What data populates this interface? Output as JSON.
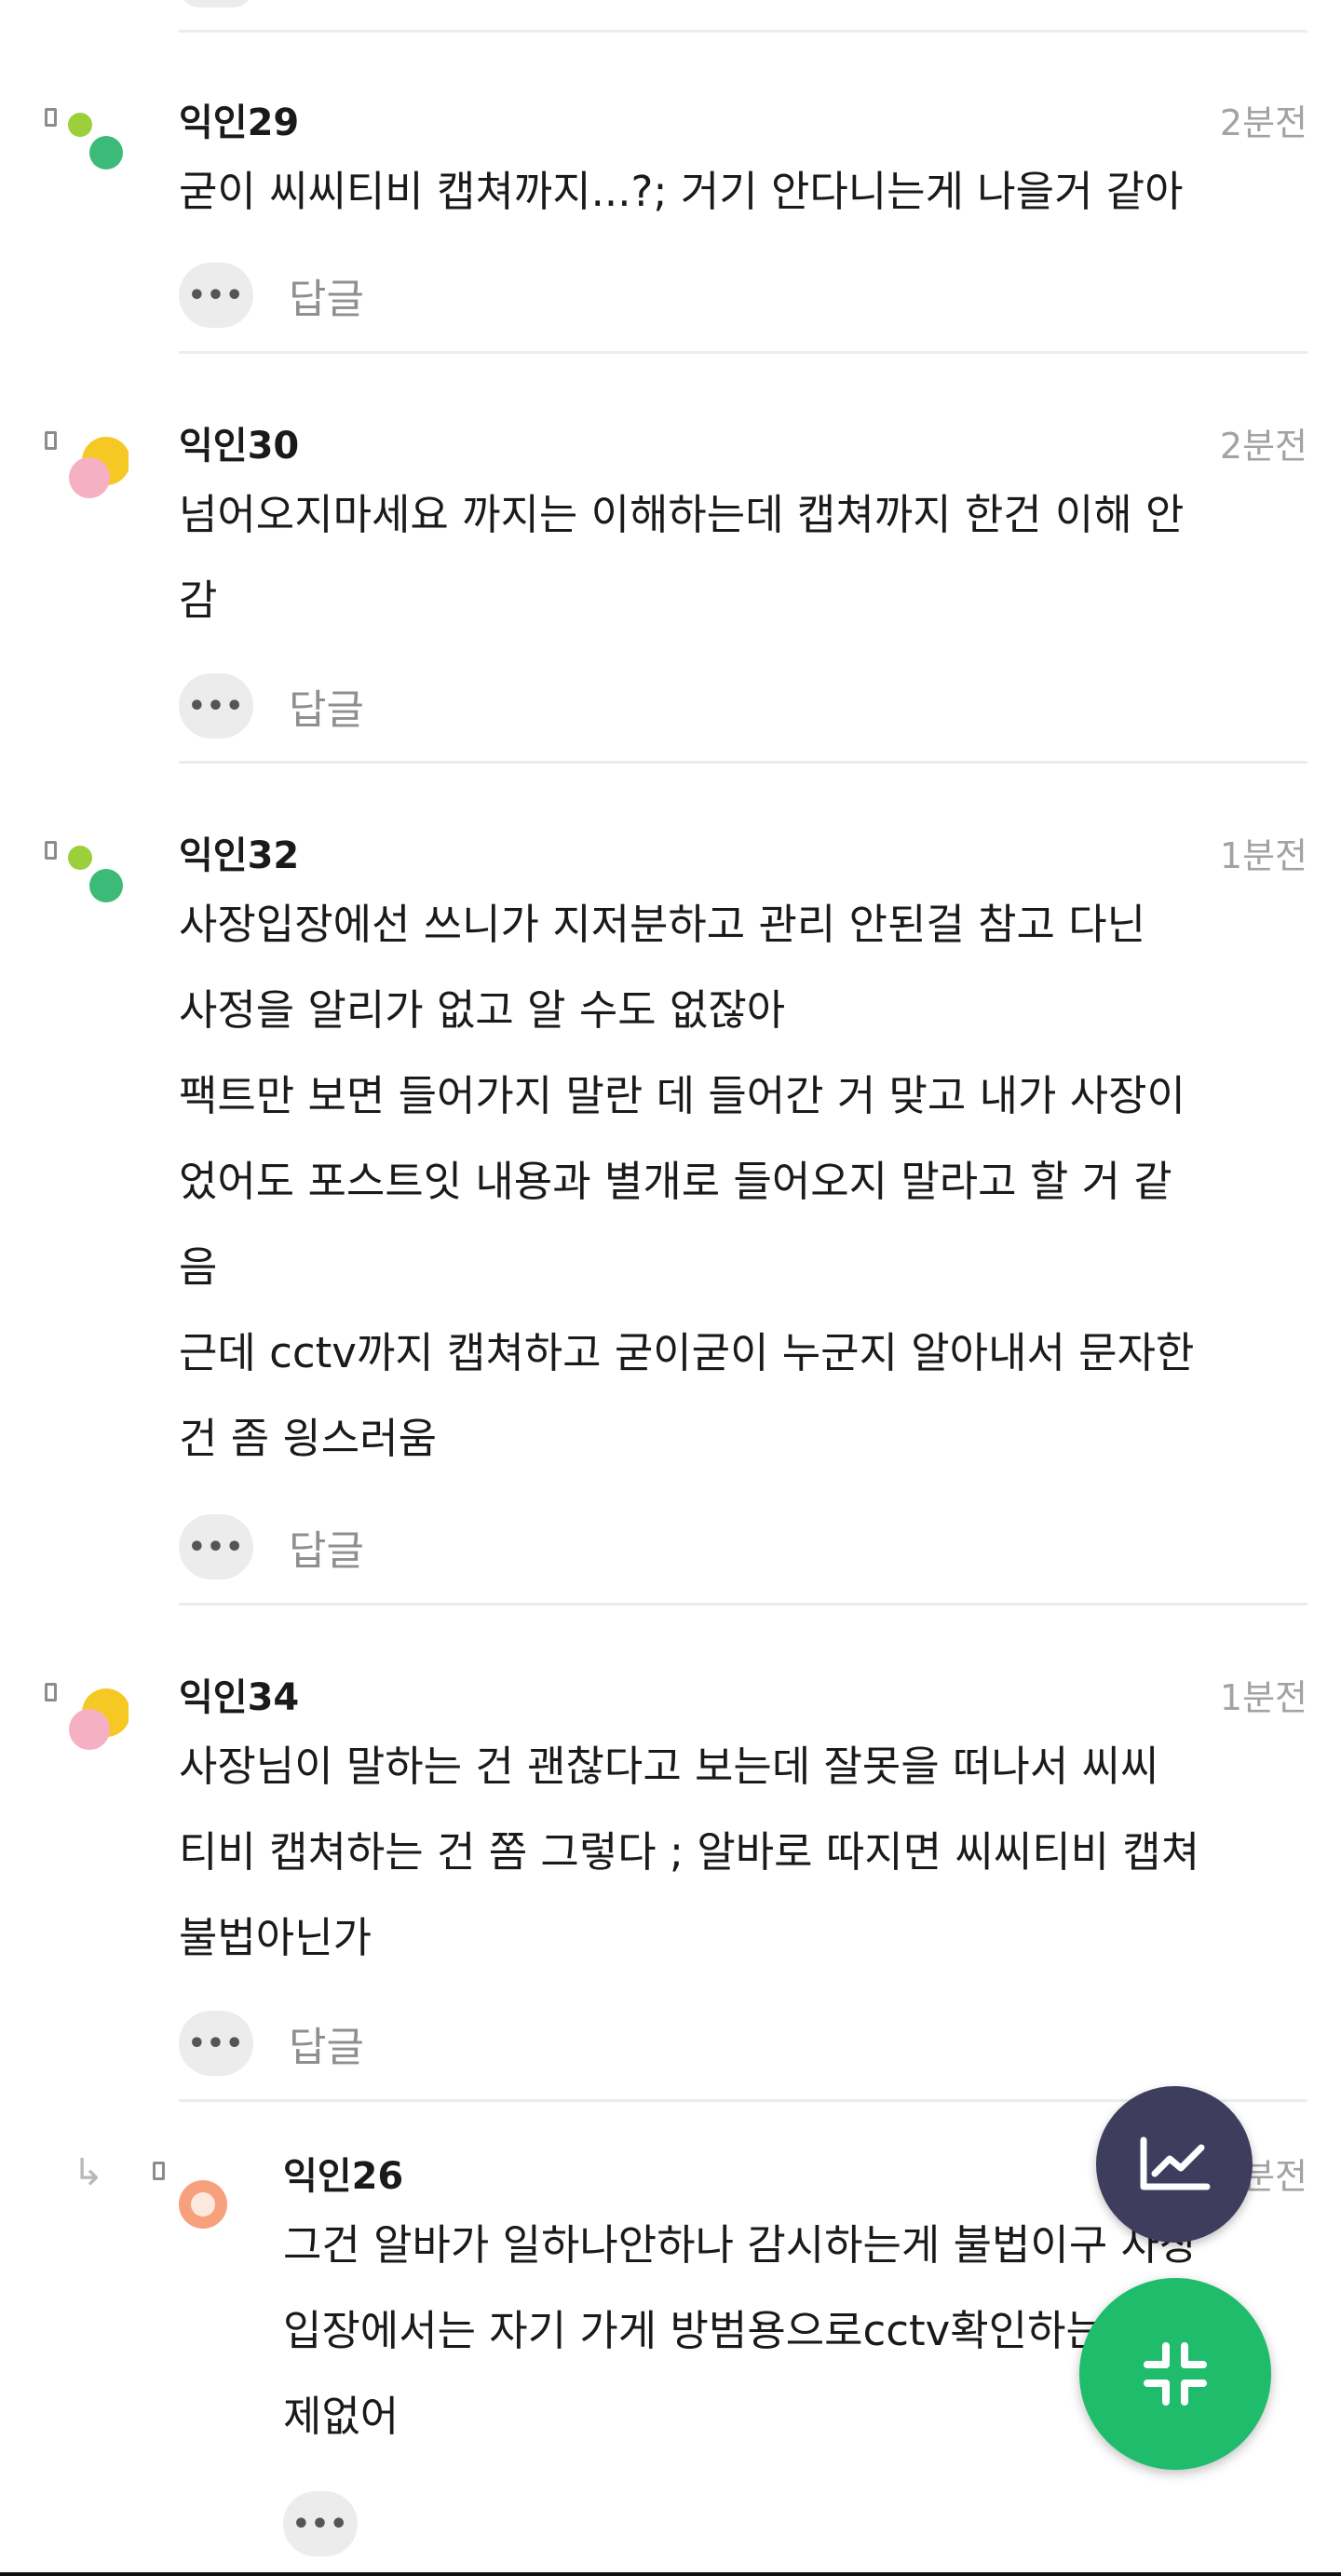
{
  "comments": [
    {
      "nickname": "익인29",
      "time": "2분전",
      "lines": [
        "굳이 씨씨티비 캡쳐까지...?; 거기 안다니는게 나을거 같아"
      ],
      "reply_label": "답글",
      "more_label": "•••",
      "avatar": "green-dots"
    },
    {
      "nickname": "익인30",
      "time": "2분전",
      "lines": [
        "넘어오지마세요 까지는 이해하는데 캡쳐까지 한건 이해 안",
        "감"
      ],
      "reply_label": "답글",
      "more_label": "•••",
      "avatar": "yellow-pink"
    },
    {
      "nickname": "익인32",
      "time": "1분전",
      "lines": [
        "사장입장에선 쓰니가 지저분하고 관리 안된걸 참고 다닌",
        "사정을 알리가 없고 알 수도 없잖아",
        "팩트만 보면 들어가지 말란 데 들어간 거 맞고 내가 사장이",
        "었어도 포스트잇 내용과 별개로 들어오지 말라고 할 거 같",
        "음",
        "근데 cctv까지 캡쳐하고 굳이굳이 누군지 알아내서 문자한",
        "건 좀 읭스러움"
      ],
      "reply_label": "답글",
      "more_label": "•••",
      "avatar": "green-dots"
    },
    {
      "nickname": "익인34",
      "time": "1분전",
      "lines": [
        "사장님이 말하는 건 괜찮다고 보는데 잘못을 떠나서 씨씨",
        "티비 캡쳐하는 건 쫌 그렇다 ; 알바로 따지면 씨씨티비 캡쳐",
        "불법아닌가"
      ],
      "reply_label": "답글",
      "more_label": "•••",
      "avatar": "yellow-pink"
    },
    {
      "nickname": "익인26",
      "time": "1분전",
      "lines": [
        "그건 알바가 일하나안하나 감시하는게 불법이구 사장",
        "입장에서는 자기 가게 방범용으로cctv확인하는건 문",
        "제없어"
      ],
      "more_label": "•••",
      "avatar": "orange-ring",
      "is_reply": true
    }
  ],
  "colors": {
    "accent_green": "#1fbc6b",
    "fab_dark": "#3e3d5e",
    "time_gray": "#a3a3a3",
    "divider": "#ececec"
  },
  "icons": {
    "fab_chart": "trend-chart-icon",
    "fab_collapse": "collapse-icon",
    "reply_indicator": "reply-arrow-icon"
  }
}
